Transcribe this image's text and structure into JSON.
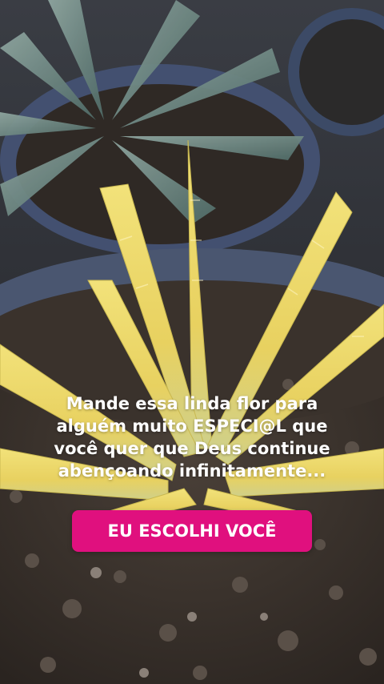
{
  "caption": {
    "lines": [
      "Mande essa linda flor para",
      "alguém muito ESPECI@L que",
      "você quer que Deus continue",
      "abençoando infinitamente..."
    ]
  },
  "cta": {
    "label": "EU ESCOLHI VOCÊ",
    "color": "#e0107e"
  },
  "photo": {
    "subject": "succulent-plant-photo"
  }
}
